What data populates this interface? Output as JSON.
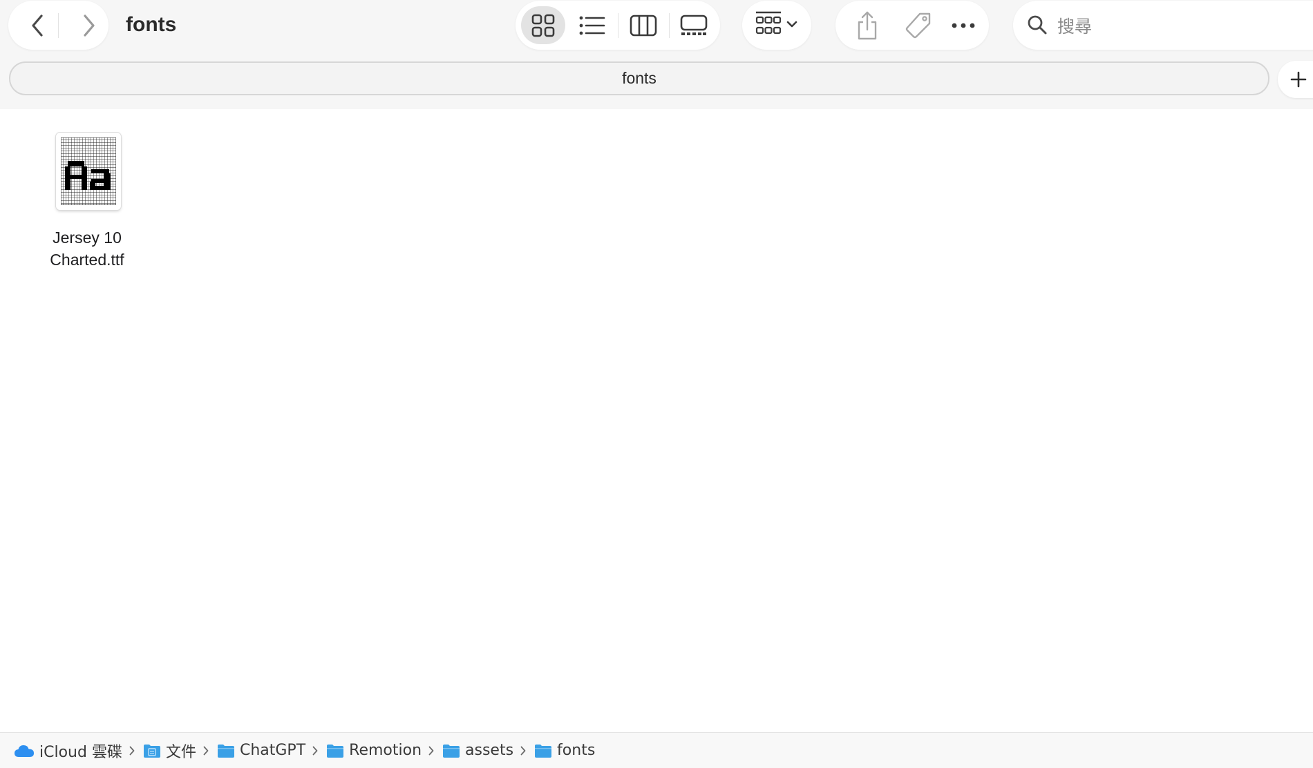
{
  "toolbar": {
    "title": "fonts",
    "search_placeholder": "搜尋",
    "nav": {
      "back_icon": "chevron-left-icon",
      "forward_icon": "chevron-right-icon"
    },
    "view_modes": [
      {
        "name": "icon-view",
        "icon": "grid-icon",
        "active": true
      },
      {
        "name": "list-view",
        "icon": "list-icon",
        "active": false
      },
      {
        "name": "column-view",
        "icon": "columns-icon",
        "active": false
      },
      {
        "name": "gallery-view",
        "icon": "gallery-icon",
        "active": false
      }
    ],
    "actions": [
      "share-icon",
      "tag-icon",
      "more-icon"
    ]
  },
  "tabs": {
    "active_label": "fonts"
  },
  "files": [
    {
      "name_line1": "Jersey 10",
      "name_line2": "Charted.ttf",
      "icon": "font-file-icon",
      "preview_text": "Aa"
    }
  ],
  "pathbar": {
    "crumbs": [
      {
        "label": "iCloud 雲碟",
        "icon": "icloud-icon"
      },
      {
        "label": "文件",
        "icon": "documents-folder-icon"
      },
      {
        "label": "ChatGPT",
        "icon": "folder-icon"
      },
      {
        "label": "Remotion",
        "icon": "folder-icon"
      },
      {
        "label": "assets",
        "icon": "folder-icon"
      },
      {
        "label": "fonts",
        "icon": "folder-icon"
      }
    ]
  },
  "colors": {
    "toolbar_bg": "#f6f6f6",
    "icon_gray": "#4a4a4a",
    "folder_blue": "#3aa0e6",
    "icloud_blue": "#2d8ff0"
  }
}
